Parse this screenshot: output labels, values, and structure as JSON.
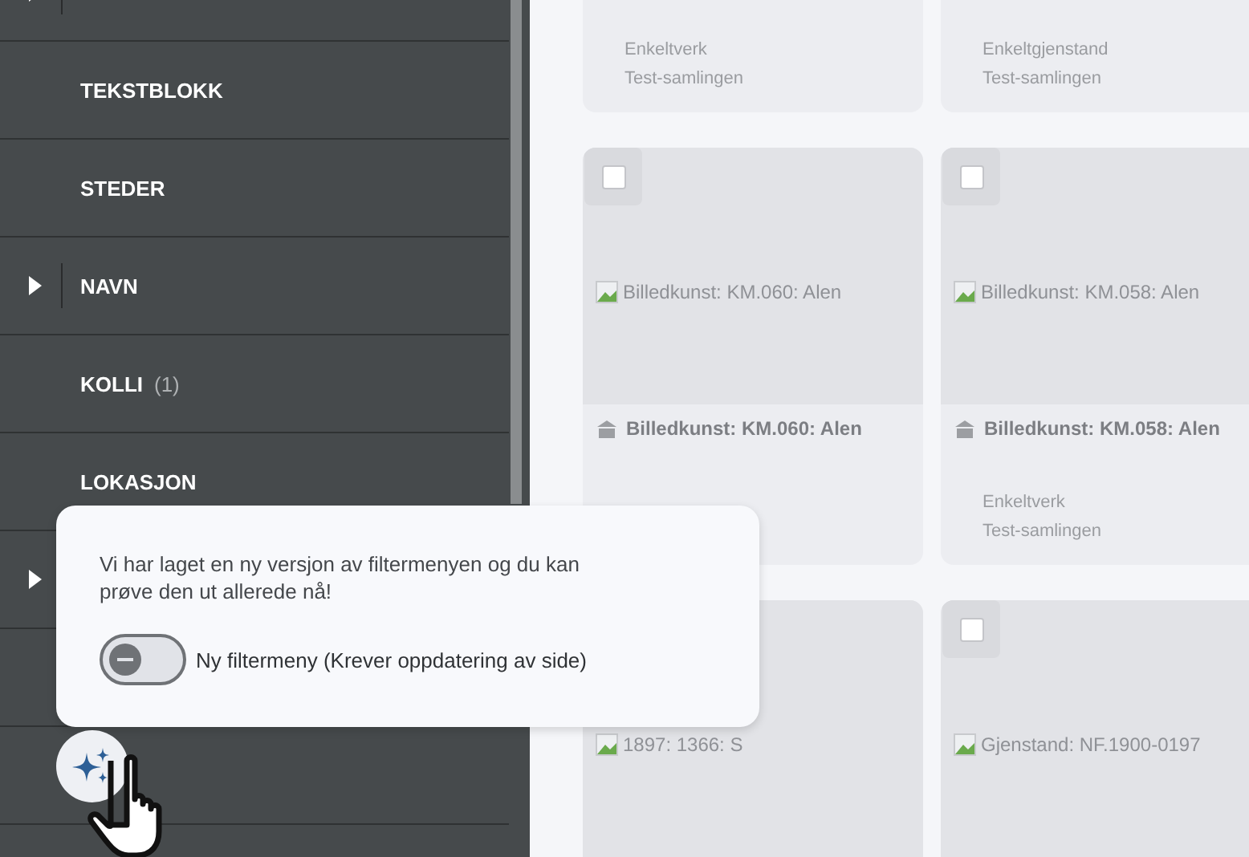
{
  "sidebar": {
    "items": [
      {
        "expandable": true
      },
      {
        "label": "TEKSTBLOKK",
        "expandable": false
      },
      {
        "label": "STEDER",
        "expandable": false
      },
      {
        "label": "NAVN",
        "expandable": true
      },
      {
        "label": "KOLLI",
        "count": "(1)",
        "expandable": false
      },
      {
        "label": "LOKASJON",
        "expandable": false
      },
      {
        "expandable": true
      },
      {
        "expandable": false
      },
      {
        "expandable": false
      }
    ]
  },
  "cards": [
    {
      "type": "Enkeltverk",
      "collection": "Test-samlingen"
    },
    {
      "type": "Enkeltgjenstand",
      "collection": "Test-samlingen"
    },
    {
      "checked": false,
      "image_alt": "Billedkunst: KM.060: Alen",
      "title": "Billedkunst: KM.060: Alen"
    },
    {
      "checked": false,
      "image_alt": "Billedkunst: KM.058: Alen",
      "title": "Billedkunst: KM.058: Alen",
      "type": "Enkeltverk",
      "collection": "Test-samlingen"
    },
    {
      "image_alt": "1897: 1366: S"
    },
    {
      "checked": false,
      "image_alt": "Gjenstand: NF.1900-0197"
    }
  ],
  "popup": {
    "message": "Vi har laget en ny versjon av filtermenyen og du kan prøve den ut allerede nå!",
    "toggle": {
      "label": "Ny filtermeny (Krever oppdatering av side)",
      "on": false
    }
  }
}
